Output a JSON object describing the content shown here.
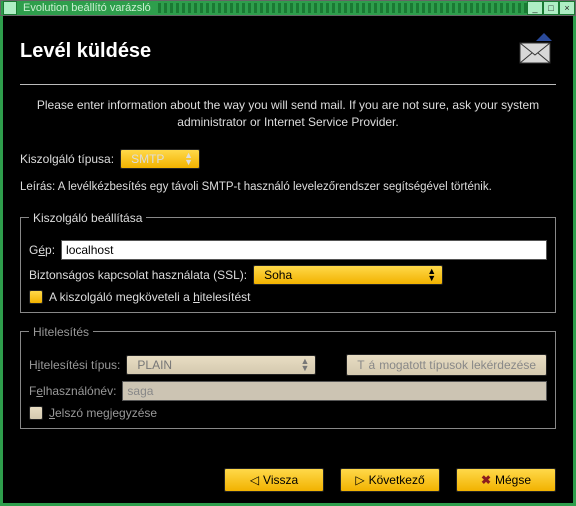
{
  "window": {
    "title": "Evolution beállító varázsló"
  },
  "header": {
    "title": "Levél küldése"
  },
  "intro": "Please enter information about the way you will send mail. If you are not sure, ask your system administrator or Internet Service Provider.",
  "server_type": {
    "label": "Kiszolgáló típusa:",
    "value": "SMTP"
  },
  "description": {
    "label": "Leírás:",
    "text": "A levélkézbesítés egy távoli SMTP-t használó levelezőrendszer segítségével történik."
  },
  "server_settings": {
    "legend": "Kiszolgáló beállítása",
    "host_label_pre": "G",
    "host_label_ul": "é",
    "host_label_post": "p:",
    "host_value": "localhost",
    "ssl_label": "Biztonságos kapcsolat használata (SSL):",
    "ssl_value": "Soha",
    "auth_required_pre": "A kiszolgáló megköveteli a ",
    "auth_required_ul": "h",
    "auth_required_post": "itelesítést"
  },
  "auth": {
    "legend": "Hitelesítés",
    "type_label_pre": "H",
    "type_label_ul": "i",
    "type_label_post": "telesítési típus:",
    "type_value": "PLAIN",
    "query_btn_pre": "T",
    "query_btn_ul": "á",
    "query_btn_post": "mogatott típusok lekérdezése",
    "user_label_pre": "F",
    "user_label_ul": "e",
    "user_label_post": "lhasználónév:",
    "user_value": "saga",
    "remember_pre": "",
    "remember_ul": "J",
    "remember_post": "elszó megjegyzése"
  },
  "footer": {
    "back": "Vissza",
    "next": "Következő",
    "cancel": "Mégse"
  }
}
